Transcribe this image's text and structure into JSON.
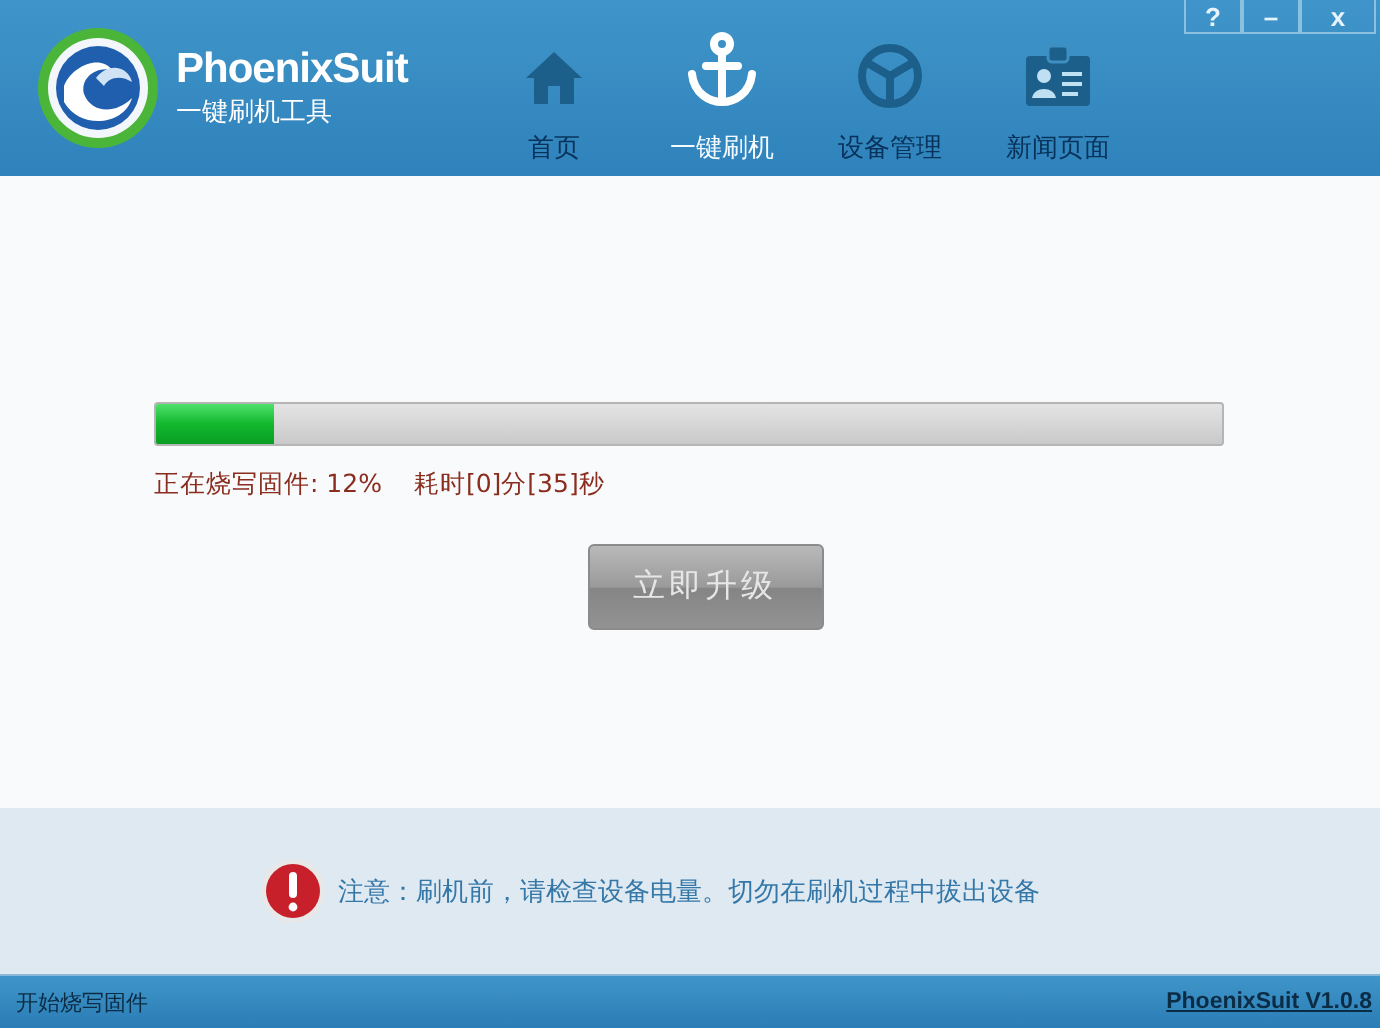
{
  "app": {
    "name": "PhoenixSuit",
    "subtitle": "一键刷机工具"
  },
  "window_buttons": [
    {
      "kind": "help",
      "label": "?"
    },
    {
      "kind": "minimize",
      "label": "–"
    },
    {
      "kind": "close",
      "label": "x"
    }
  ],
  "tabs": [
    {
      "kind": "home",
      "label": "首页",
      "selected": false
    },
    {
      "kind": "flash",
      "label": "一键刷机",
      "selected": true
    },
    {
      "kind": "devices",
      "label": "设备管理",
      "selected": false
    },
    {
      "kind": "news",
      "label": "新闻页面",
      "selected": false
    }
  ],
  "progress": {
    "level": 0.11,
    "status": "正在烧写固件: 12%",
    "elapsed": "耗时[0]分[35]秒"
  },
  "upgrade_button": {
    "label": "立即升级",
    "disabled": true
  },
  "notice": "注意：刷机前，请检查设备电量。切勿在刷机过程中拔出设备",
  "status_bar": {
    "message": "开始烧写固件",
    "version": "PhoenixSuit V1.0.8"
  }
}
